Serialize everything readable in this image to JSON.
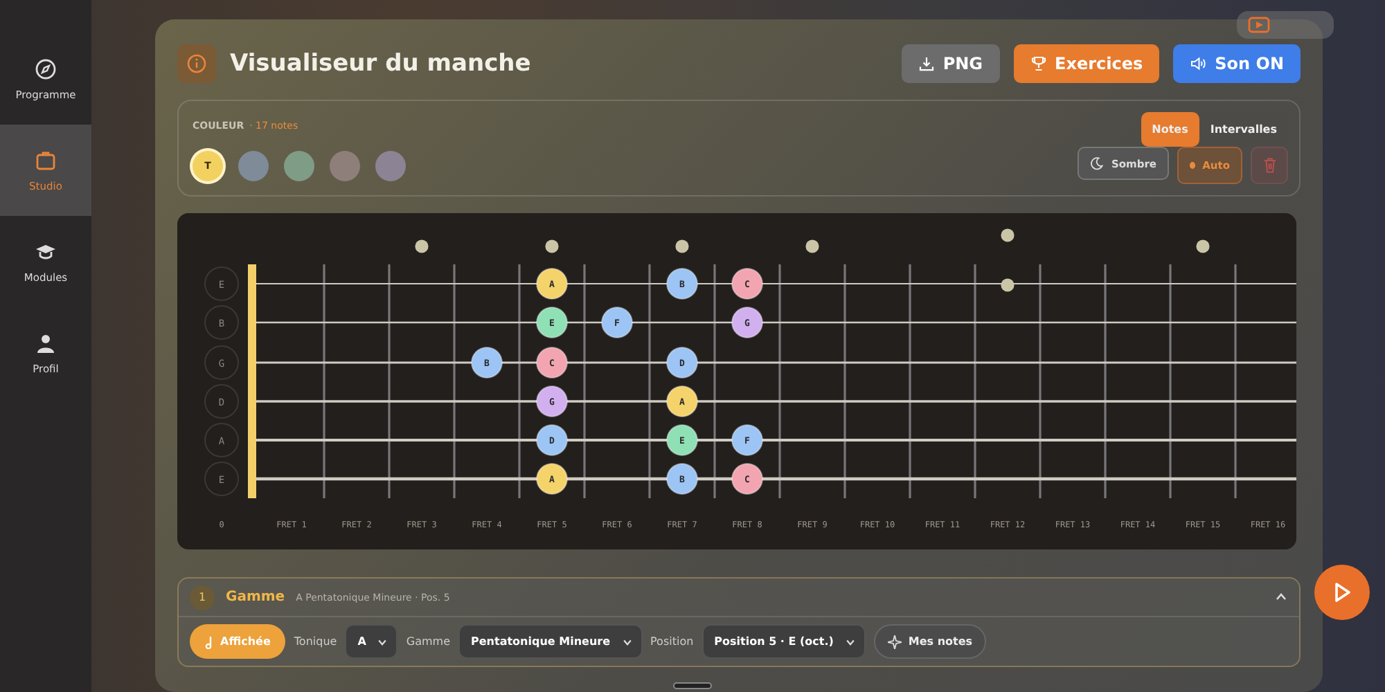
{
  "sidebar": {
    "items": [
      {
        "label": "Programme",
        "selected": false
      },
      {
        "label": "Studio",
        "selected": true
      },
      {
        "label": "Modules",
        "selected": false
      },
      {
        "label": "Profil",
        "selected": false
      }
    ]
  },
  "header": {
    "title": "Visualiseur du manche",
    "buttons": [
      {
        "label": "PNG",
        "kind": "download"
      },
      {
        "label": "Exercices",
        "kind": "trophy"
      },
      {
        "label": "Son ON",
        "kind": "sound"
      }
    ]
  },
  "color_panel": {
    "label": "COULEUR",
    "count": "· 17 notes",
    "swatches": [
      {
        "text": "T",
        "color": "#f3d160",
        "selected": true
      },
      {
        "color": "#7f8b99",
        "selected": false
      },
      {
        "color": "#7f9c86",
        "selected": false
      },
      {
        "color": "#8f7f7a",
        "selected": false
      },
      {
        "color": "#8c8494",
        "selected": false
      }
    ],
    "modes": [
      {
        "label": "Notes",
        "selected": true
      },
      {
        "label": "Intervalles",
        "selected": false
      }
    ],
    "theme_button": "Sombre",
    "auto_button": {
      "label": "Auto",
      "on": true
    }
  },
  "fretboard": {
    "strings": [
      "E",
      "B",
      "G",
      "D",
      "A",
      "E"
    ],
    "frets": [
      {
        "label": "0",
        "kind": "open"
      },
      {
        "label": "FRET 1",
        "kind": "plain"
      },
      {
        "label": "FRET 2",
        "kind": "plain"
      },
      {
        "label": "FRET 3",
        "kind": "inlay"
      },
      {
        "label": "FRET 4",
        "kind": "plain",
        "notes": [
          {
            "kind": "empty"
          },
          {
            "kind": "empty"
          },
          {
            "kind": "note",
            "note": "B",
            "color": "#9cc4f5"
          },
          {
            "kind": "empty"
          },
          {
            "kind": "empty"
          },
          {
            "kind": "empty"
          }
        ]
      },
      {
        "label": "FRET 5",
        "kind": "inlay",
        "notes": [
          {
            "kind": "note",
            "note": "A",
            "color": "#f5d36b"
          },
          {
            "kind": "note",
            "note": "E",
            "color": "#8fe0b5"
          },
          {
            "kind": "note",
            "note": "C",
            "color": "#f2a5b0"
          },
          {
            "kind": "note",
            "note": "G",
            "color": "#d2b0f0"
          },
          {
            "kind": "note",
            "note": "D",
            "color": "#9cc4f5"
          },
          {
            "kind": "note",
            "note": "A",
            "color": "#f5d36b"
          }
        ]
      },
      {
        "label": "FRET 6",
        "kind": "plain",
        "notes": [
          {
            "kind": "empty"
          },
          {
            "kind": "note",
            "note": "F",
            "color": "#9cc4f5"
          },
          {
            "kind": "empty"
          },
          {
            "kind": "empty"
          },
          {
            "kind": "empty"
          },
          {
            "kind": "empty"
          }
        ]
      },
      {
        "label": "FRET 7",
        "kind": "inlay",
        "notes": [
          {
            "kind": "note",
            "note": "B",
            "color": "#9cc4f5"
          },
          {
            "kind": "empty"
          },
          {
            "kind": "note",
            "note": "D",
            "color": "#9cc4f5"
          },
          {
            "kind": "note",
            "note": "A",
            "color": "#f5d36b"
          },
          {
            "kind": "note",
            "note": "E",
            "color": "#8fe0b5"
          },
          {
            "kind": "note",
            "note": "B",
            "color": "#9cc4f5"
          }
        ]
      },
      {
        "label": "FRET 8",
        "kind": "plain",
        "notes": [
          {
            "kind": "note",
            "note": "C",
            "color": "#f2a5b0"
          },
          {
            "kind": "note",
            "note": "G",
            "color": "#d2b0f0"
          },
          {
            "kind": "empty"
          },
          {
            "kind": "empty"
          },
          {
            "kind": "note",
            "note": "F",
            "color": "#9cc4f5"
          },
          {
            "kind": "note",
            "note": "C",
            "color": "#f2a5b0"
          }
        ]
      },
      {
        "label": "FRET 9",
        "kind": "inlay"
      },
      {
        "label": "FRET 10",
        "kind": "plain"
      },
      {
        "label": "FRET 11",
        "kind": "plain"
      },
      {
        "label": "FRET 12",
        "kind": "double_inlay"
      },
      {
        "label": "FRET 13",
        "kind": "plain"
      },
      {
        "label": "FRET 14",
        "kind": "plain"
      },
      {
        "label": "FRET 15",
        "kind": "inlay"
      },
      {
        "label": "FRET 16",
        "kind": "plain"
      }
    ]
  },
  "layer": {
    "number": "1",
    "title": "Gamme",
    "subtitle": "A Pentatonique Mineure · Pos. 5",
    "expanded": true,
    "shown_button": "Affichée",
    "fields": [
      {
        "label": "Tonique",
        "value": "A"
      },
      {
        "label": "Gamme",
        "value": "Pentatonique Mineure"
      },
      {
        "label": "Position",
        "value": "Position 5 · E (oct.)"
      }
    ],
    "notes_button": "Mes notes"
  }
}
